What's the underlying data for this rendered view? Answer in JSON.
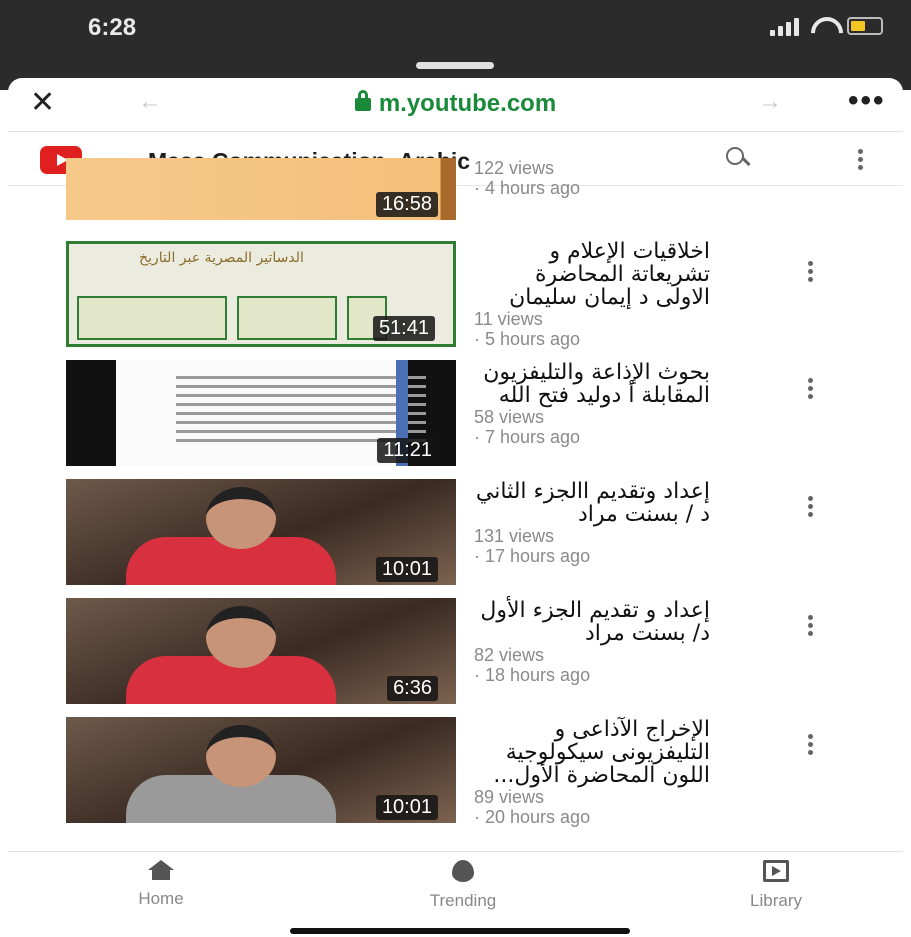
{
  "status_bar": {
    "time": "6:28"
  },
  "browser": {
    "close_icon": "close-icon",
    "url": "m.youtube.com",
    "back_arrow": "←",
    "forward_arrow": "→",
    "more_label": "•••",
    "url_color": "#1a8a3a"
  },
  "header": {
    "channel_title": "Mass Communication_Arabic",
    "brand_color": "#e02020"
  },
  "videos": [
    {
      "title": "",
      "views": "122 views",
      "time": "· 4 hours ago",
      "duration": "16:58"
    },
    {
      "title": "اخلاقيات الإعلام و تشريعاتة المحاضرة الاولى د إيمان سليمان",
      "views": "11 views",
      "time": "· 5 hours ago",
      "duration": "51:41",
      "thumb_heading": "الدساتير المصرية عبر التاريخ"
    },
    {
      "title": "بحوث الإذاعة والتليفزيون المقابلة أ دوليد فتح الله",
      "views": "58 views",
      "time": "· 7 hours ago",
      "duration": "11:21"
    },
    {
      "title": "إعداد وتقديم االجزء الثاني د / بسنت مراد",
      "views": "131 views",
      "time": "· 17 hours ago",
      "duration": "10:01"
    },
    {
      "title": "إعداد و تقديم الجزء الأول د/ بسنت مراد",
      "views": "82 views",
      "time": "· 18 hours ago",
      "duration": "6:36"
    },
    {
      "title": "الإخراج الآذاعى و التليفزيونى سيكولوجية اللون المحاضرة الأول...",
      "views": "89 views",
      "time": "· 20 hours ago",
      "duration": "10:01"
    }
  ],
  "bottom_nav": [
    {
      "label": "Home",
      "icon": "home-icon"
    },
    {
      "label": "Trending",
      "icon": "trending-icon"
    },
    {
      "label": "Library",
      "icon": "library-icon"
    }
  ]
}
